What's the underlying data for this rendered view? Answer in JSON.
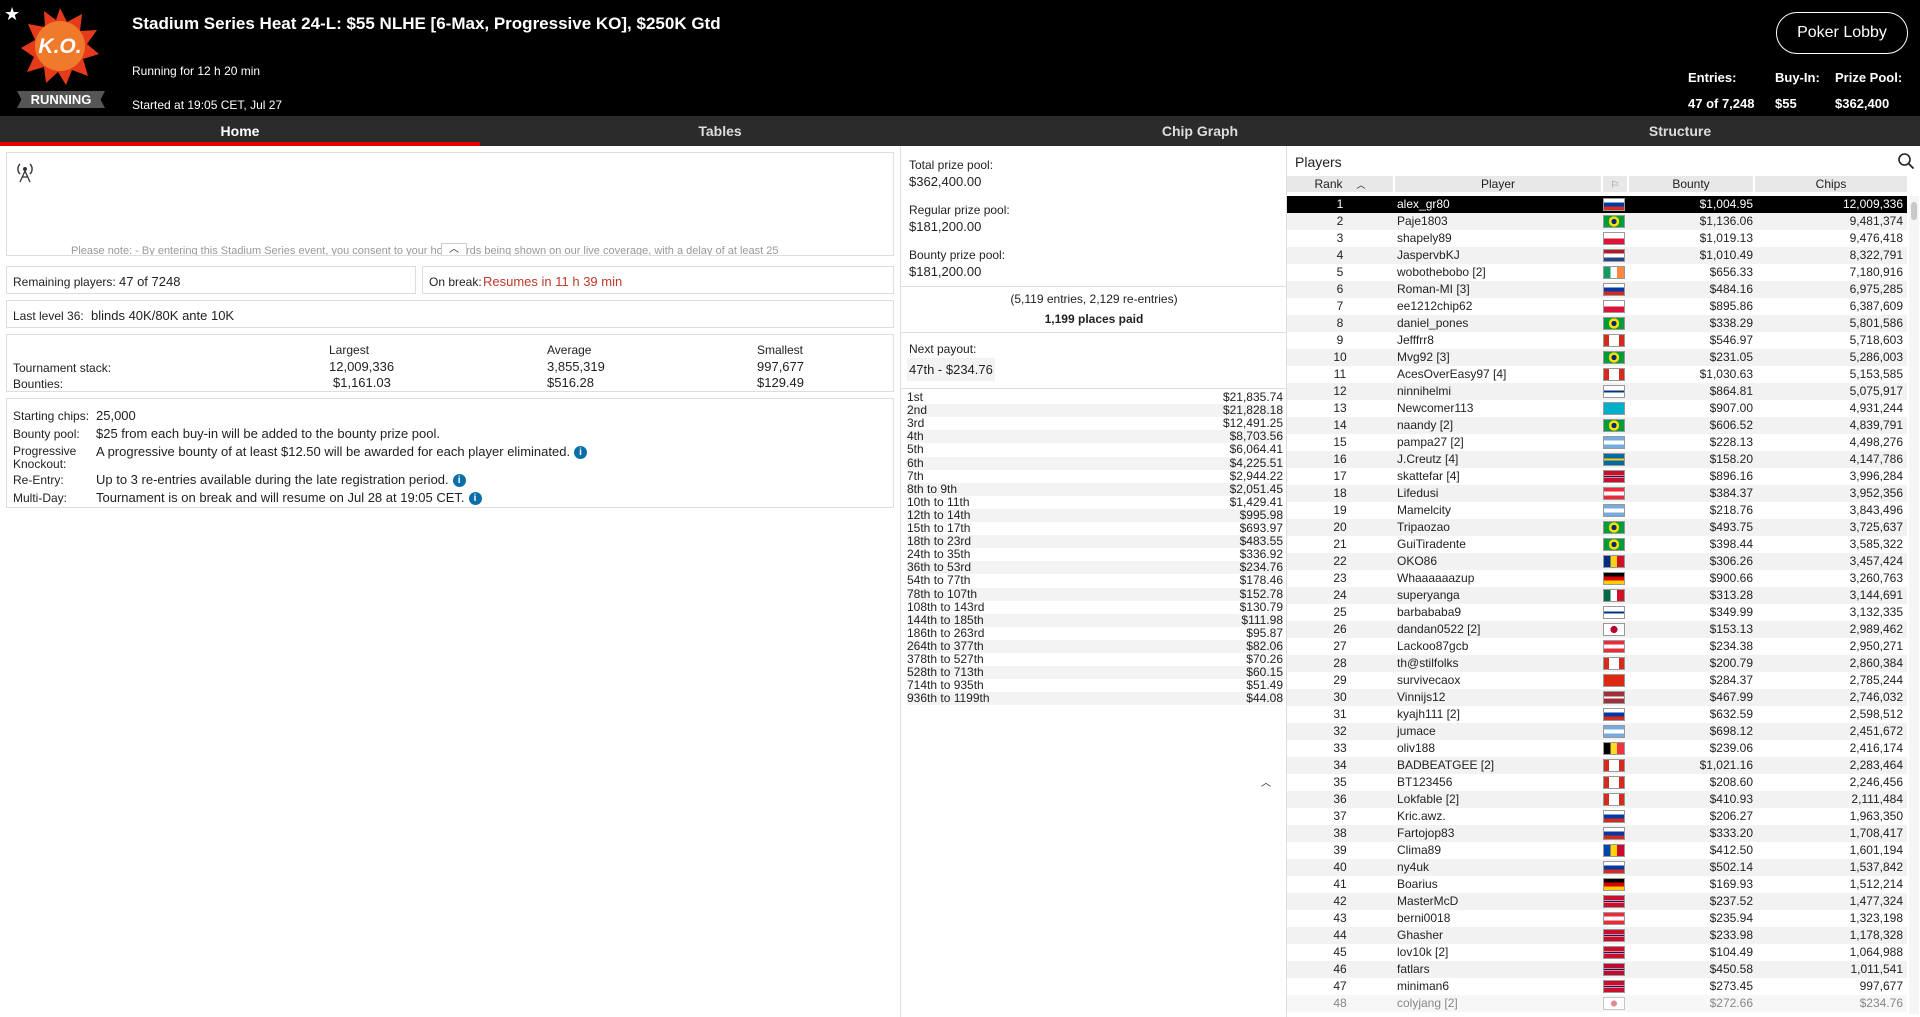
{
  "header": {
    "title": "Stadium Series Heat 24-L: $55 NLHE [6-Max, Progressive KO], $250K Gtd",
    "running_for": "Running for 12 h 20 min",
    "started": "Started at 19:05 CET, Jul 27",
    "status_badge": "RUNNING",
    "logo_text": "K.O.",
    "lobby_button": "Poker Lobby",
    "entries_label": "Entries:",
    "entries_value": "47 of 7,248",
    "buyin_label": "Buy-In:",
    "buyin_value": "$55",
    "prizepool_label": "Prize Pool:",
    "prizepool_value": "$362,400"
  },
  "tabs": [
    "Home",
    "Tables",
    "Chip Graph",
    "Structure"
  ],
  "home": {
    "note_text": "Please note: - By entering this Stadium Series event, you consent to your hole cards being shown on our live coverage, with a delay of at least 25",
    "remaining_label": "Remaining players:",
    "remaining_value": "47 of 7248",
    "break_label": "On break:",
    "break_value": "Resumes in 11 h 39 min",
    "last_level_label": "Last level 36:",
    "last_level_value": "blinds 40K/80K ante 10K",
    "stats_headers": [
      "Largest",
      "Average",
      "Smallest"
    ],
    "stack_label": "Tournament stack:",
    "stack_values": [
      "12,009,336",
      "3,855,319",
      "997,677"
    ],
    "bounties_label": "Bounties:",
    "bounties_values": [
      "$1,161.03",
      "$516.28",
      "$129.49"
    ],
    "starting_chips_label": "Starting chips:",
    "starting_chips_value": "25,000",
    "bounty_pool_label": "Bounty pool:",
    "bounty_pool_value": "$25 from each buy-in will be added to the bounty prize pool.",
    "pko_label": "Progressive Knockout:",
    "pko_value": "A progressive bounty of at least $12.50 will be awarded for each player eliminated.",
    "reentry_label": "Re-Entry:",
    "reentry_value": "Up to 3 re-entries available during the late registration period.",
    "multiday_label": "Multi-Day:",
    "multiday_value": "Tournament is on break and will resume on Jul 28 at 19:05 CET."
  },
  "prize": {
    "total_label": "Total prize pool:",
    "total_value": "$362,400.00",
    "regular_label": "Regular prize pool:",
    "regular_value": "$181,200.00",
    "bounty_label": "Bounty prize pool:",
    "bounty_value": "$181,200.00",
    "entries_note": "(5,119 entries, 2,129 re-entries)",
    "places_paid": "1,199 places paid",
    "next_payout_label": "Next payout:",
    "next_payout_value": "47th - $234.76",
    "payouts": [
      [
        "1st",
        "$21,835.74"
      ],
      [
        "2nd",
        "$21,828.18"
      ],
      [
        "3rd",
        "$12,491.25"
      ],
      [
        "4th",
        "$8,703.56"
      ],
      [
        "5th",
        "$6,064.41"
      ],
      [
        "6th",
        "$4,225.51"
      ],
      [
        "7th",
        "$2,944.22"
      ],
      [
        "8th to 9th",
        "$2,051.45"
      ],
      [
        "10th to 11th",
        "$1,429.41"
      ],
      [
        "12th to 14th",
        "$995.98"
      ],
      [
        "15th to 17th",
        "$693.97"
      ],
      [
        "18th to 23rd",
        "$483.55"
      ],
      [
        "24th to 35th",
        "$336.92"
      ],
      [
        "36th to 53rd",
        "$234.76"
      ],
      [
        "54th to 77th",
        "$178.46"
      ],
      [
        "78th to 107th",
        "$152.78"
      ],
      [
        "108th to 143rd",
        "$130.79"
      ],
      [
        "144th to 185th",
        "$111.98"
      ],
      [
        "186th to 263rd",
        "$95.87"
      ],
      [
        "264th to 377th",
        "$82.06"
      ],
      [
        "378th to 527th",
        "$70.26"
      ],
      [
        "528th to 713th",
        "$60.15"
      ],
      [
        "714th to 935th",
        "$51.49"
      ],
      [
        "936th to 1199th",
        "$44.08"
      ]
    ]
  },
  "players": {
    "title": "Players",
    "columns": [
      "Rank",
      "Player",
      "Bounty",
      "Chips"
    ],
    "rows": [
      [
        1,
        "alex_gr80",
        "$1,004.95",
        "12,009,336",
        "ru"
      ],
      [
        2,
        "Paje1803",
        "$1,136.06",
        "9,481,374",
        "br"
      ],
      [
        3,
        "shapely89",
        "$1,019.13",
        "9,476,418",
        "pl"
      ],
      [
        4,
        "JaspervbKJ",
        "$1,010.49",
        "8,322,791",
        "nl"
      ],
      [
        5,
        "wobothebobo [2]",
        "$656.33",
        "7,180,916",
        "ie"
      ],
      [
        6,
        "Roman-MI [3]",
        "$484.16",
        "6,975,285",
        "ru"
      ],
      [
        7,
        "ee1212chip62",
        "$895.86",
        "6,387,609",
        "pl"
      ],
      [
        8,
        "daniel_pones",
        "$338.29",
        "5,801,586",
        "br"
      ],
      [
        9,
        "Jefffrr8",
        "$546.97",
        "5,718,603",
        "ca"
      ],
      [
        10,
        "Mvg92 [3]",
        "$231.05",
        "5,286,003",
        "br"
      ],
      [
        11,
        "AcesOverEasy97 [4]",
        "$1,030.63",
        "5,153,585",
        "ca"
      ],
      [
        12,
        "ninnihelmi",
        "$864.81",
        "5,075,917",
        "fi"
      ],
      [
        13,
        "Newcomer113",
        "$907.00",
        "4,931,244",
        "kz"
      ],
      [
        14,
        "naandy [2]",
        "$606.52",
        "4,839,791",
        "br"
      ],
      [
        15,
        "pampa27 [2]",
        "$228.13",
        "4,498,276",
        "ar"
      ],
      [
        16,
        "J.Creutz [4]",
        "$158.20",
        "4,147,786",
        "se"
      ],
      [
        17,
        "skattefar [4]",
        "$896.16",
        "3,996,284",
        "gb"
      ],
      [
        18,
        "Lifedusi",
        "$384.37",
        "3,952,356",
        "at"
      ],
      [
        19,
        "Mamelcity",
        "$218.76",
        "3,843,496",
        "ar"
      ],
      [
        20,
        "Tripaozao",
        "$493.75",
        "3,725,637",
        "br"
      ],
      [
        21,
        "GuiTiradente",
        "$398.44",
        "3,585,322",
        "br"
      ],
      [
        22,
        "OKO86",
        "$306.26",
        "3,457,424",
        "ro"
      ],
      [
        23,
        "Whaaaaaazup",
        "$900.66",
        "3,260,763",
        "de"
      ],
      [
        24,
        "superyanga",
        "$313.28",
        "3,144,691",
        "mx"
      ],
      [
        25,
        "barbababa9",
        "$349.99",
        "3,132,335",
        "fi"
      ],
      [
        26,
        "dandan0522 [2]",
        "$153.13",
        "2,989,462",
        "jp"
      ],
      [
        27,
        "Lackoo87gcb",
        "$234.38",
        "2,950,271",
        "at"
      ],
      [
        28,
        "th@stilfolks",
        "$200.79",
        "2,860,384",
        "ca"
      ],
      [
        29,
        "survivecaox",
        "$284.37",
        "2,785,244",
        "cn"
      ],
      [
        30,
        "Vinnijs12",
        "$467.99",
        "2,746,032",
        "lv"
      ],
      [
        31,
        "kyajh111 [2]",
        "$632.59",
        "2,598,512",
        "ru"
      ],
      [
        32,
        "jumace",
        "$698.12",
        "2,451,672",
        "ar"
      ],
      [
        33,
        "oliv188",
        "$239.06",
        "2,416,174",
        "be"
      ],
      [
        34,
        "BADBEATGEE [2]",
        "$1,021.16",
        "2,283,464",
        "ca"
      ],
      [
        35,
        "BT123456",
        "$208.60",
        "2,246,456",
        "ca"
      ],
      [
        36,
        "Lokfable [2]",
        "$410.93",
        "2,111,484",
        "ca"
      ],
      [
        37,
        "Kric.awz.",
        "$206.27",
        "1,963,350",
        "ru"
      ],
      [
        38,
        "Fartojop83",
        "$333.20",
        "1,708,417",
        "ru"
      ],
      [
        39,
        "Clima89",
        "$412.50",
        "1,601,194",
        "md"
      ],
      [
        40,
        "ny4uk",
        "$502.14",
        "1,537,842",
        "ru"
      ],
      [
        41,
        "Boarius",
        "$169.93",
        "1,512,214",
        "de"
      ],
      [
        42,
        "MasterMcD",
        "$237.52",
        "1,477,324",
        "gb"
      ],
      [
        43,
        "berni0018",
        "$235.94",
        "1,323,198",
        "at"
      ],
      [
        44,
        "Ghasher",
        "$233.98",
        "1,178,328",
        "gb"
      ],
      [
        45,
        "lov10k [2]",
        "$104.49",
        "1,064,988",
        "gb"
      ],
      [
        46,
        "fatlars",
        "$450.58",
        "1,011,541",
        "no"
      ],
      [
        47,
        "miniman6",
        "$273.45",
        "997,677",
        "gb"
      ],
      [
        48,
        "colyjang [2]",
        "$272.66",
        "$234.76",
        "kr"
      ]
    ]
  },
  "colors": {
    "accent": "#e60000",
    "break_text": "#c0392b",
    "info": "#0a6fa8"
  }
}
